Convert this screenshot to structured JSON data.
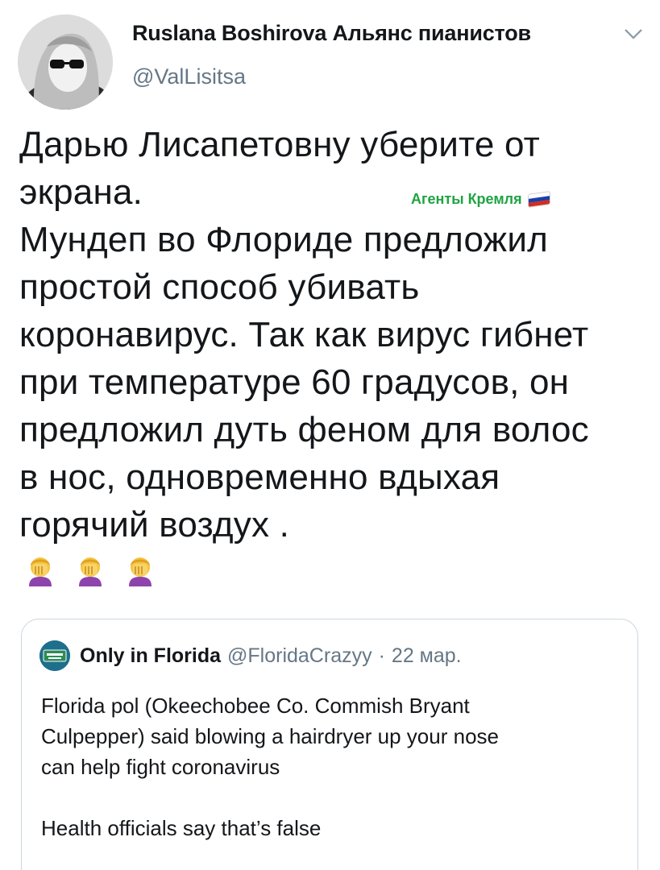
{
  "author": {
    "name": "Ruslana Boshirova Альянс пианистов",
    "handle": "@ValLisitsa"
  },
  "tweet": {
    "lines": [
      "Дарью Лисапетовну уберите от",
      "экрана.",
      "Мундеп во Флориде предложил",
      "простой способ убивать",
      "коронавирус. Так как вирус гибнет",
      "при температуре 60 градусов, он",
      "предложил дуть феном для волос",
      "в нос, одновременно вдыхая",
      "горячий воздух ."
    ],
    "emojis": [
      "facepalm-emoji",
      "facepalm-emoji",
      "facepalm-emoji"
    ]
  },
  "overlay": {
    "label": "Агенты Кремля",
    "flag_colors": [
      "#ffffff",
      "#1c3fa8",
      "#d52b1e"
    ]
  },
  "quote": {
    "name": "Only in Florida",
    "handle": "@FloridaCrazyy",
    "separator": "·",
    "date": "22 мар.",
    "lines": [
      "Florida pol (Okeechobee Co. Commish Bryant",
      "Culpepper) said blowing a hairdryer up your nose",
      "can help fight coronavirus"
    ],
    "lines2": [
      "Health officials say that’s false"
    ]
  },
  "colors": {
    "text": "#14171a",
    "secondary": "#657786",
    "border": "#ccd6dd",
    "overlay_green": "#1fa342"
  }
}
